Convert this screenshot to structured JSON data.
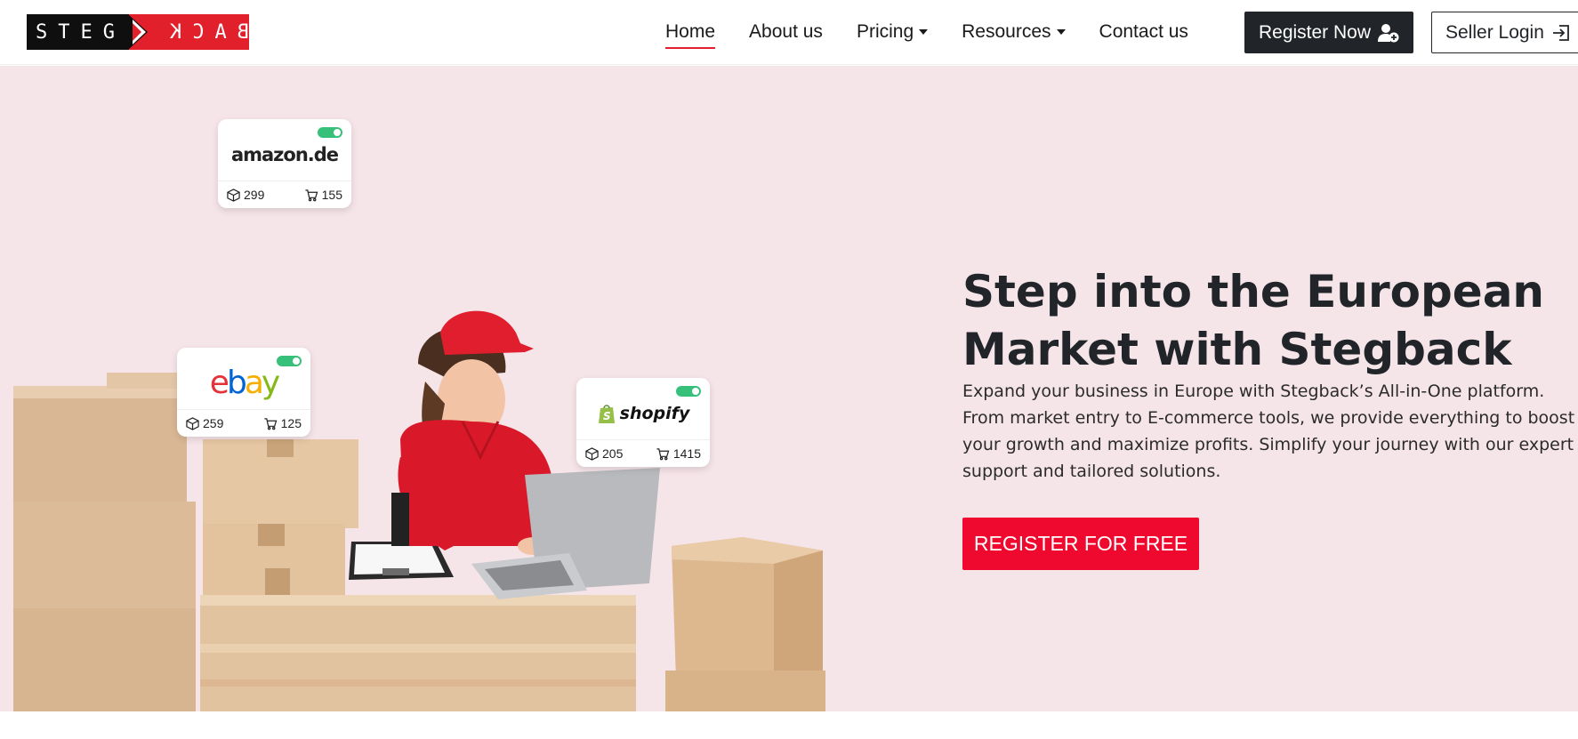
{
  "logo": {
    "left_text": "STEG",
    "right_text": "BACK"
  },
  "nav": {
    "items": [
      {
        "label": "Home",
        "active": true,
        "dropdown": false
      },
      {
        "label": "About us",
        "active": false,
        "dropdown": false
      },
      {
        "label": "Pricing",
        "active": false,
        "dropdown": true
      },
      {
        "label": "Resources",
        "active": false,
        "dropdown": true
      },
      {
        "label": "Contact us",
        "active": false,
        "dropdown": false
      }
    ],
    "register_label": "Register Now",
    "login_label": "Seller Login"
  },
  "hero": {
    "title": "Step into the European Market with Stegback",
    "description": "Expand your business in Europe with Stegback’s All-in-One platform. From market entry to E-commerce tools, we provide everything to boost your growth and maximize profits. Simplify your journey with our expert support and tailored solutions.",
    "cta_label": "REGISTER FOR FREE",
    "marketplaces": [
      {
        "name": "amazon.de",
        "products": "299",
        "orders": "155",
        "enabled": true
      },
      {
        "name": "ebay",
        "products": "259",
        "orders": "125",
        "enabled": true
      },
      {
        "name": "shopify",
        "products": "205",
        "orders": "1415",
        "enabled": true
      }
    ]
  },
  "colors": {
    "accent_red": "#f0092e",
    "logo_red": "#e2202c",
    "dark": "#212529",
    "hero_bg": "#f5e4e8",
    "toggle_green": "#36c07a"
  }
}
